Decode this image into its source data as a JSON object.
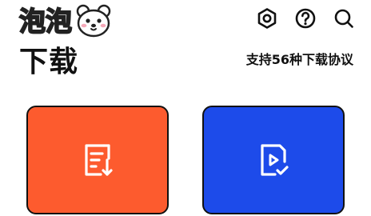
{
  "header": {
    "brand_name": "泡泡",
    "icons": [
      "bear-logo-icon",
      "settings-hex-icon",
      "help-icon",
      "search-icon"
    ]
  },
  "title": {
    "page_title": "下载",
    "protocol_text": "支持56种下载协议"
  },
  "cards": [
    {
      "icon": "document-download-icon",
      "color": "#fd5b2e"
    },
    {
      "icon": "video-file-check-icon",
      "color": "#1d4bea"
    }
  ]
}
